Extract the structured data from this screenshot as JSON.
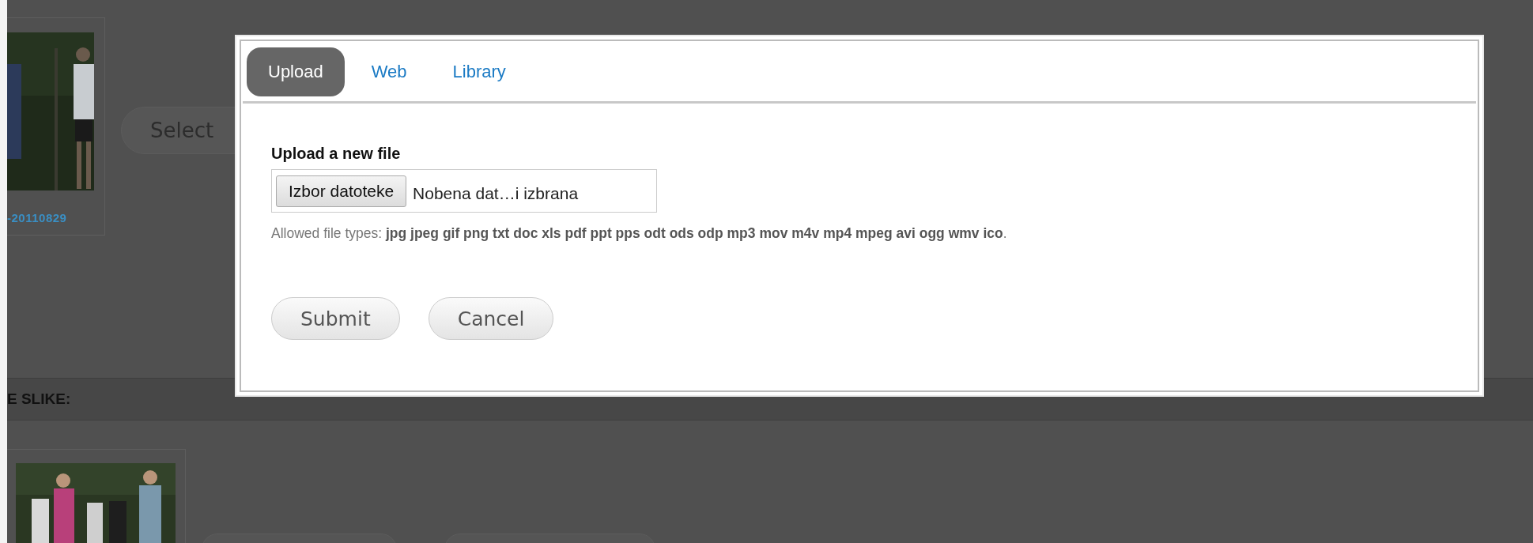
{
  "background": {
    "top_item": {
      "caption": "-20110829",
      "button": "Select"
    },
    "section_heading": "E SLIKE:"
  },
  "dialog": {
    "tabs": [
      {
        "label": "Upload",
        "selected": true
      },
      {
        "label": "Web",
        "selected": false
      },
      {
        "label": "Library",
        "selected": false
      }
    ],
    "upload": {
      "label": "Upload a new file",
      "choose_button": "Izbor datoteke",
      "file_status": "Nobena dat…i izbrana",
      "allowed": "Allowed file types: **jpg jpeg gif png txt doc xls pdf ppt pps odt ods odp mp3 mov m4v mp4 mpeg avi ogg wmv ico**."
    },
    "buttons": [
      "Submit",
      "Cancel"
    ]
  }
}
